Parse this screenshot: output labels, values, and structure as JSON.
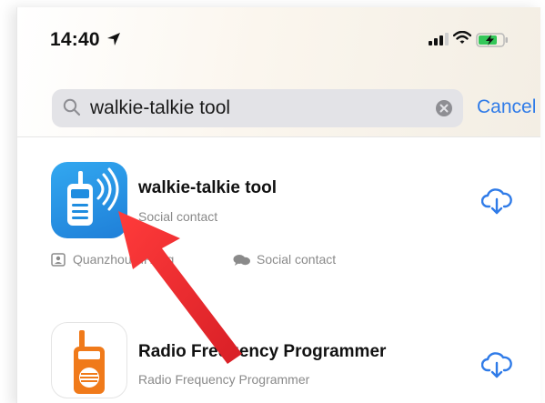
{
  "status_bar": {
    "time": "14:40",
    "location_icon": "location-arrow-icon",
    "signal_icon": "cellular-signal-icon",
    "wifi_icon": "wifi-icon",
    "battery_icon": "battery-charging-icon"
  },
  "search": {
    "query": "walkie-talkie tool",
    "search_icon": "magnifier-icon",
    "clear_icon": "clear-icon",
    "cancel_label": "Cancel"
  },
  "results": [
    {
      "title": "walkie-talkie tool",
      "subtitle": "Social contact",
      "developer": "QuanzhouDiHeng",
      "category": "Social contact",
      "icon": "walkie-talkie-app-icon",
      "download_icon": "cloud-download-icon"
    },
    {
      "title": "Radio Frequency Programmer",
      "subtitle": "Radio Frequency Programmer",
      "icon": "radio-programmer-app-icon",
      "download_icon": "cloud-download-icon"
    }
  ],
  "colors": {
    "accent": "#2f7be8",
    "annotation_arrow": "#e8232a",
    "app1_icon_bg": "#1f8de0",
    "app2_icon_accent": "#f07a1a"
  }
}
